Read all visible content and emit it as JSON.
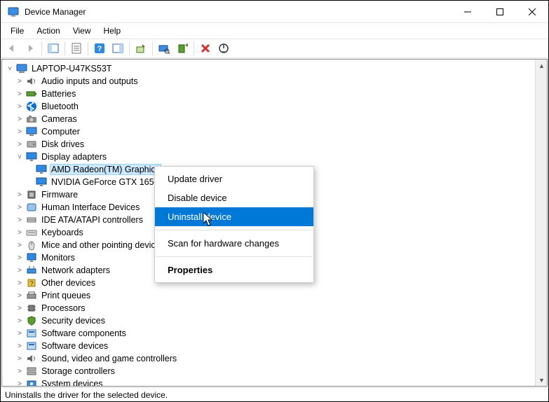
{
  "titlebar": {
    "title": "Device Manager"
  },
  "menubar": [
    "File",
    "Action",
    "View",
    "Help"
  ],
  "tree": {
    "root": "LAPTOP-U47KS53T",
    "categories": [
      {
        "label": "Audio inputs and outputs",
        "icon": "speaker-icon"
      },
      {
        "label": "Batteries",
        "icon": "battery-icon"
      },
      {
        "label": "Bluetooth",
        "icon": "bluetooth-icon"
      },
      {
        "label": "Cameras",
        "icon": "camera-icon"
      },
      {
        "label": "Computer",
        "icon": "computer-icon"
      },
      {
        "label": "Disk drives",
        "icon": "disk-icon"
      },
      {
        "label": "Display adapters",
        "icon": "display-icon",
        "expanded": true,
        "children": [
          {
            "label": "AMD Radeon(TM) Graphics",
            "selected": true
          },
          {
            "label": "NVIDIA GeForce GTX 1650"
          }
        ]
      },
      {
        "label": "Firmware",
        "icon": "firmware-icon"
      },
      {
        "label": "Human Interface Devices",
        "icon": "hid-icon"
      },
      {
        "label": "IDE ATA/ATAPI controllers",
        "icon": "ide-icon"
      },
      {
        "label": "Keyboards",
        "icon": "keyboard-icon"
      },
      {
        "label": "Mice and other pointing devices",
        "icon": "mouse-icon"
      },
      {
        "label": "Monitors",
        "icon": "monitor-icon"
      },
      {
        "label": "Network adapters",
        "icon": "network-icon"
      },
      {
        "label": "Other devices",
        "icon": "other-icon"
      },
      {
        "label": "Print queues",
        "icon": "printer-icon"
      },
      {
        "label": "Processors",
        "icon": "cpu-icon"
      },
      {
        "label": "Security devices",
        "icon": "security-icon"
      },
      {
        "label": "Software components",
        "icon": "software-icon"
      },
      {
        "label": "Software devices",
        "icon": "software-icon"
      },
      {
        "label": "Sound, video and game controllers",
        "icon": "sound-icon"
      },
      {
        "label": "Storage controllers",
        "icon": "storage-icon"
      },
      {
        "label": "System devices",
        "icon": "system-icon"
      }
    ]
  },
  "context_menu": {
    "items": [
      {
        "label": "Update driver"
      },
      {
        "label": "Disable device"
      },
      {
        "label": "Uninstall device",
        "highlight": true
      },
      {
        "separator": true
      },
      {
        "label": "Scan for hardware changes"
      },
      {
        "separator": true
      },
      {
        "label": "Properties",
        "bold": true
      }
    ]
  },
  "statusbar": {
    "text": "Uninstalls the driver for the selected device."
  }
}
